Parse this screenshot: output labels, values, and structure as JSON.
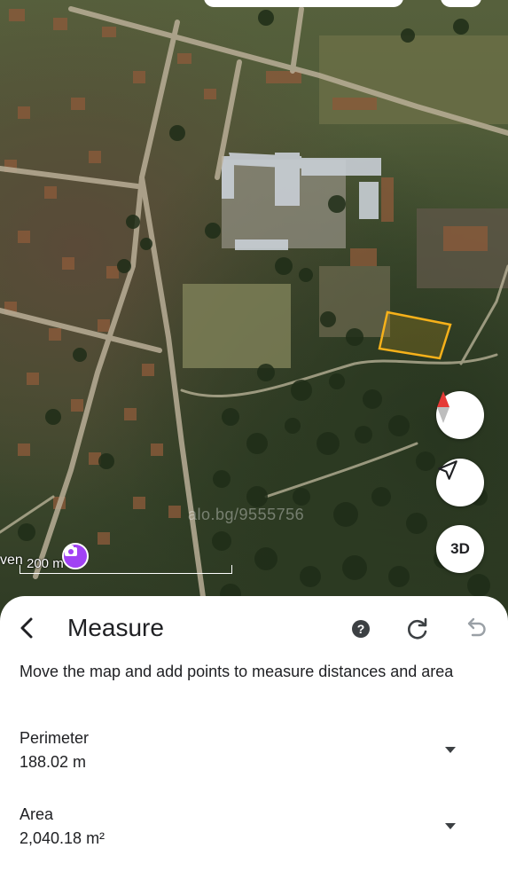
{
  "map": {
    "watermark": "alo.bg/9555756",
    "scale_label": "200 m",
    "place_label": "ven",
    "buttons": {
      "three_d_label": "3D"
    },
    "colors": {
      "measure_polygon": "#f6b11a",
      "compass_red": "#e53935",
      "place_pin": "#a142f4"
    }
  },
  "sheet": {
    "title": "Measure",
    "instructions": "Move the map and add points to measure distances and area",
    "perimeter": {
      "label": "Perimeter",
      "value": "188.02 m"
    },
    "area": {
      "label": "Area",
      "value": "2,040.18 m²"
    },
    "icons": {
      "back": "back-arrow-icon",
      "help": "help-icon",
      "refresh": "refresh-icon",
      "undo": "undo-icon",
      "expand": "caret-down-icon"
    }
  }
}
